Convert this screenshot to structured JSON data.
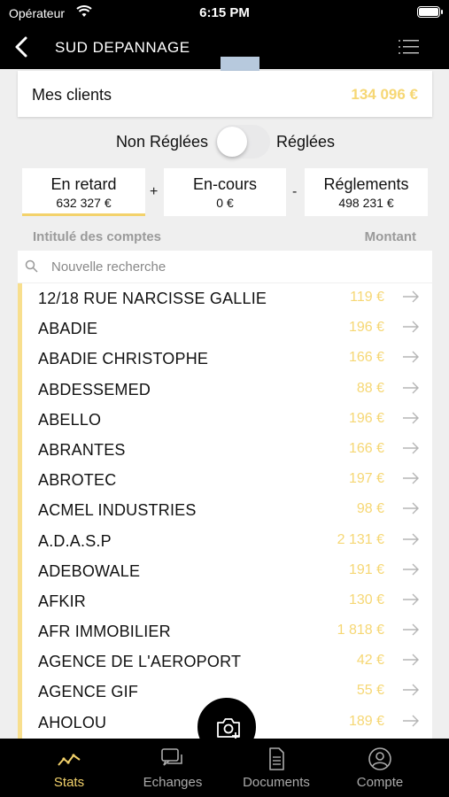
{
  "status_bar": {
    "carrier": "Opérateur",
    "time": "6:15 PM"
  },
  "nav": {
    "title": "SUD DEPANNAGE"
  },
  "summary": {
    "label": "Mes clients",
    "amount": "134 096 €"
  },
  "filter": {
    "left_label": "Non Réglées",
    "right_label": "Réglées",
    "on": false
  },
  "stats": {
    "late": {
      "title": "En retard",
      "value": "632 327 €"
    },
    "plus": "+",
    "current": {
      "title": "En-cours",
      "value": "0 €"
    },
    "minus": "-",
    "payments": {
      "title": "Réglements",
      "value": "498 231 €"
    }
  },
  "table": {
    "col_name": "Intitulé des comptes",
    "col_amount": "Montant"
  },
  "search": {
    "placeholder": "Nouvelle recherche"
  },
  "accounts": [
    {
      "name": "12/18 RUE NARCISSE GALLIE",
      "amount": "119 €"
    },
    {
      "name": "ABADIE",
      "amount": "196 €"
    },
    {
      "name": "ABADIE CHRISTOPHE",
      "amount": "166 €"
    },
    {
      "name": "ABDESSEMED",
      "amount": "88 €"
    },
    {
      "name": "ABELLO",
      "amount": "196 €"
    },
    {
      "name": "ABRANTES",
      "amount": "166 €"
    },
    {
      "name": "ABROTEC",
      "amount": "197 €"
    },
    {
      "name": "ACMEL INDUSTRIES",
      "amount": "98 €"
    },
    {
      "name": "A.D.A.S.P",
      "amount": "2 131 €"
    },
    {
      "name": "ADEBOWALE",
      "amount": "191 €"
    },
    {
      "name": "AFKIR",
      "amount": "130 €"
    },
    {
      "name": "AFR IMMOBILIER",
      "amount": "1 818 €"
    },
    {
      "name": "AGENCE DE L'AEROPORT",
      "amount": "42 €"
    },
    {
      "name": "AGENCE GIF",
      "amount": "55 €"
    },
    {
      "name": "AHOLOU",
      "amount": "189 €"
    }
  ],
  "tabs": [
    {
      "label": "Stats",
      "icon": "chart-line-icon",
      "active": true
    },
    {
      "label": "Echanges",
      "icon": "chat-icon",
      "active": false
    },
    {
      "label": "Documents",
      "icon": "document-icon",
      "active": false
    },
    {
      "label": "Compte",
      "icon": "user-icon",
      "active": false
    }
  ],
  "colors": {
    "accent": "#f3d26b",
    "amount": "#f6d774",
    "bar": "#000000"
  }
}
